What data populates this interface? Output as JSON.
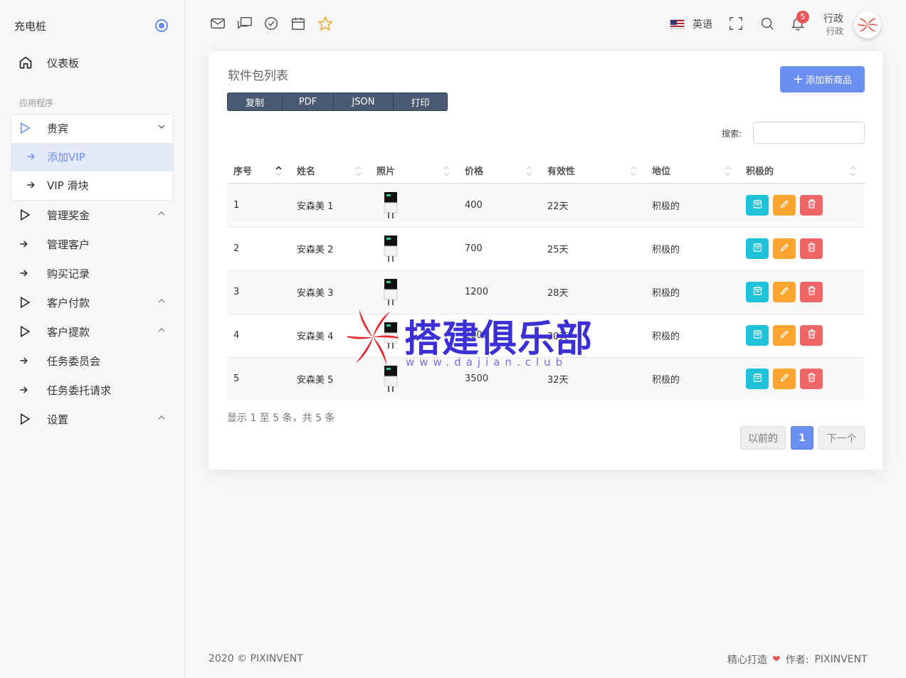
{
  "sidebar": {
    "brand": "充电桩",
    "dashboard": "仪表板",
    "section_title": "应用程序",
    "vip_group": "贵宾",
    "vip_sub": [
      "添加VIP",
      "VIP 滑块"
    ],
    "items": [
      "管理奖金",
      "管理客户",
      "购买记录",
      "客户付款",
      "客户提款",
      "任务委员会",
      "任务委托请求",
      "设置"
    ]
  },
  "header": {
    "language": "英语",
    "notification_count": "5",
    "user_name": "行政",
    "user_role": "行政"
  },
  "card": {
    "title": "软件包列表",
    "add_button": "添加新商品",
    "export_buttons": [
      "复制",
      "PDF",
      "JSON",
      "打印"
    ],
    "search_label": "搜索:",
    "columns": [
      "序号",
      "姓名",
      "照片",
      "价格",
      "有效性",
      "地位",
      "积极的"
    ],
    "rows": [
      {
        "id": "1",
        "name": "安森美 1",
        "price": "400",
        "validity": "22天",
        "status": "积极的"
      },
      {
        "id": "2",
        "name": "安森美 2",
        "price": "700",
        "validity": "25天",
        "status": "积极的"
      },
      {
        "id": "3",
        "name": "安森美 3",
        "price": "1200",
        "validity": "28天",
        "status": "积极的"
      },
      {
        "id": "4",
        "name": "安森美 4",
        "price": "2000",
        "validity": "30天",
        "status": "积极的"
      },
      {
        "id": "5",
        "name": "安森美 5",
        "price": "3500",
        "validity": "32天",
        "status": "积极的"
      }
    ],
    "info": "显示 1 至 5 条，共 5 条",
    "pagination": {
      "prev": "以前的",
      "current": "1",
      "next": "下一个"
    }
  },
  "watermark": {
    "text": "搭建俱乐部",
    "url": "www.dajian.club"
  },
  "footer": {
    "copyright": "2020 © PIXINVENT",
    "made_with": "精心打造",
    "author_label": "作者:",
    "author": "PIXINVENT"
  },
  "colors": {
    "primary": "#6b8ff0",
    "info": "#1fc3d9",
    "warning": "#ffa52f",
    "danger": "#f06565"
  }
}
